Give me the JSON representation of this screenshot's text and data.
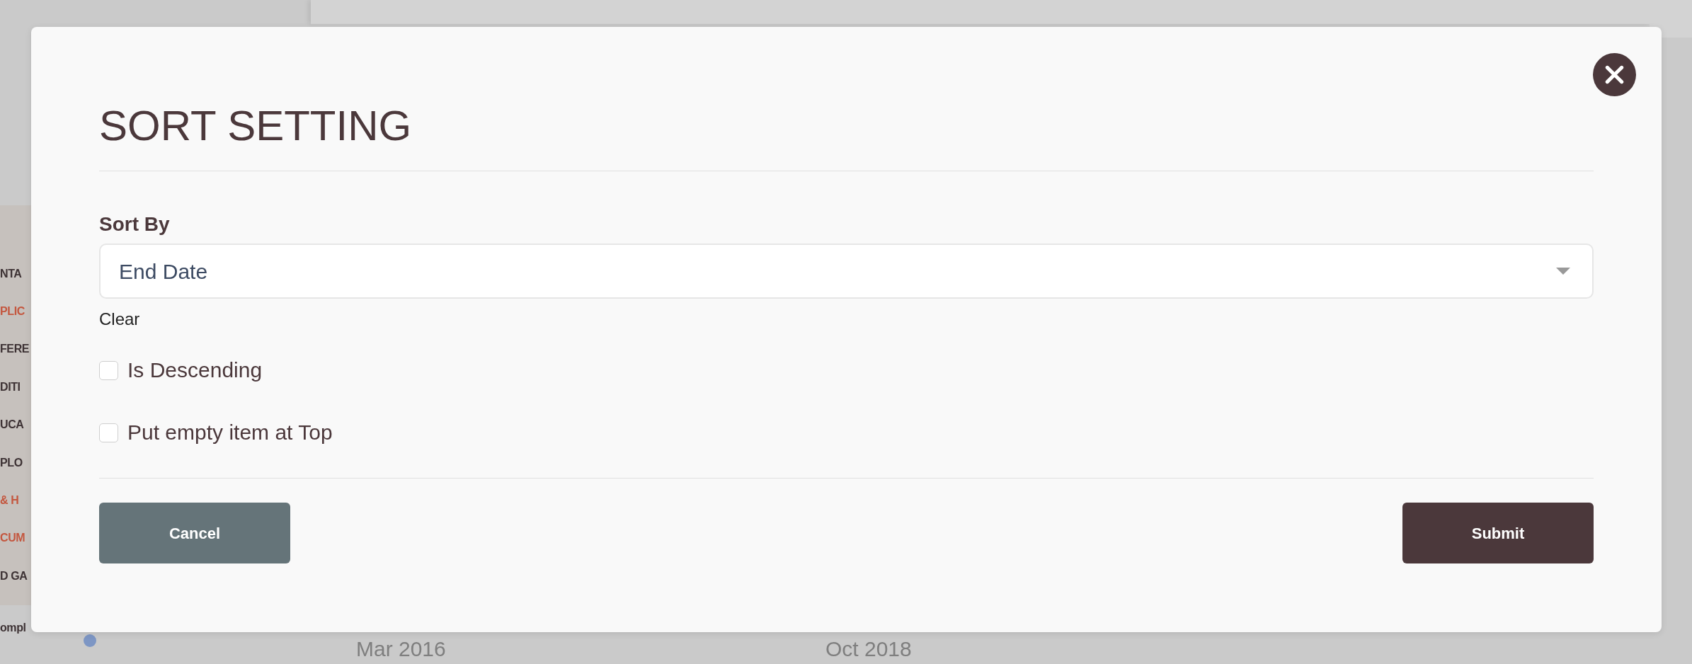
{
  "background": {
    "sidebar_items": [
      {
        "label": "NTA",
        "color": "#3d3234"
      },
      {
        "label": "PLIC",
        "color": "#c4573f"
      },
      {
        "label": "FERE",
        "color": "#3d3234"
      },
      {
        "label": "DITI",
        "color": "#3d3234"
      },
      {
        "label": "UCA",
        "color": "#3d3234"
      },
      {
        "label": "PLO",
        "color": "#3d3234"
      },
      {
        "label": "& H",
        "color": "#c4573f"
      },
      {
        "label": "CUM",
        "color": "#c4573f"
      },
      {
        "label": "D GA",
        "color": "#3d3234"
      }
    ],
    "footer_item": {
      "label": "ompl"
    },
    "dates": [
      "Mar 2016",
      "Oct 2018"
    ]
  },
  "dialog": {
    "title": "SORT SETTING",
    "sort_by": {
      "label": "Sort By",
      "value": "End Date",
      "clear": "Clear"
    },
    "options": [
      {
        "label": "Is Descending",
        "checked": false
      },
      {
        "label": "Put empty item at Top",
        "checked": false
      }
    ],
    "buttons": [
      {
        "label": "Cancel",
        "kind": "secondary"
      },
      {
        "label": "Submit",
        "kind": "primary"
      }
    ]
  }
}
